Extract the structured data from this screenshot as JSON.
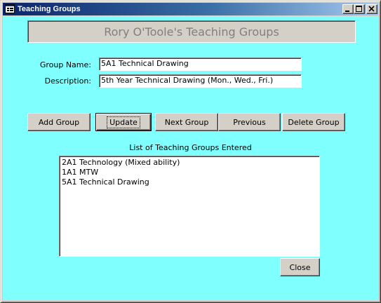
{
  "window": {
    "title": "Teaching Groups",
    "colors": {
      "client_bg": "#80ffff",
      "titlebar": "#0a246a",
      "face": "#d4d0c8",
      "header_text": "#808080"
    }
  },
  "header": {
    "title": "Rory O'Toole's Teaching Groups"
  },
  "form": {
    "group_name_label": "Group Name:",
    "group_name_value": "5A1 Technical Drawing",
    "description_label": "Description:",
    "description_value": "5th Year Technical Drawing (Mon., Wed., Fri.)"
  },
  "buttons": {
    "add": "Add Group",
    "update": "Update",
    "next": "Next Group",
    "previous": "Previous",
    "delete": "Delete Group",
    "close": "Close"
  },
  "list": {
    "caption": "List of Teaching Groups Entered",
    "items": [
      {
        "label": "2A1 Technology (Mixed ability)"
      },
      {
        "label": "1A1 MTW"
      },
      {
        "label": "5A1 Technical Drawing"
      }
    ]
  }
}
